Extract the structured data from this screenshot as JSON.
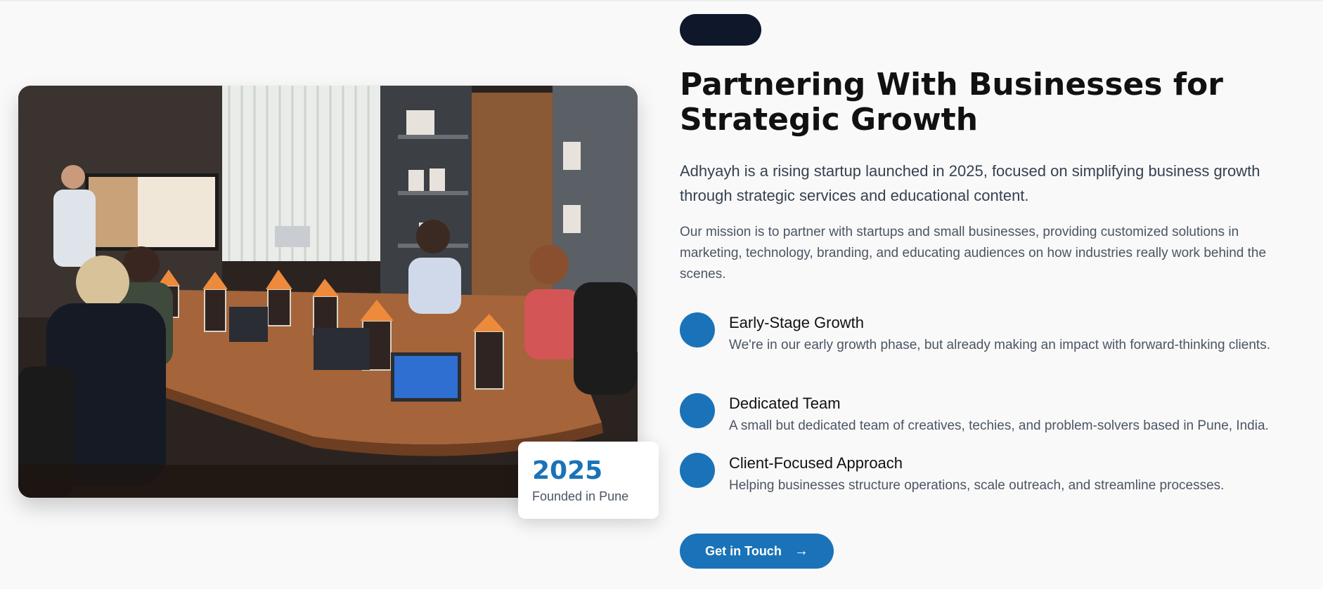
{
  "hero": {
    "heading": "Partnering With Businesses for Strategic Growth",
    "lead": "Adhyayh is a rising startup launched in 2025, focused on simplifying business growth through strategic services and educational content.",
    "mission": "Our mission is to partner with startups and small businesses, providing customized solutions in marketing, technology, branding, and educating audiences on how industries really work behind the scenes."
  },
  "stat": {
    "value": "2025",
    "label": "Founded in Pune"
  },
  "features": [
    {
      "title": "Early-Stage Growth",
      "description": "We're in our early growth phase, but already making an impact with forward-thinking clients."
    },
    {
      "title": "Dedicated Team",
      "description": "A small but dedicated team of creatives, techies, and problem-solvers based in Pune, India."
    },
    {
      "title": "Client-Focused Approach",
      "description": "Helping businesses structure operations, scale outreach, and streamline processes."
    }
  ],
  "cta": {
    "label": "Get in Touch",
    "icon": "arrow-right-icon"
  },
  "colors": {
    "accent": "#1a73b8",
    "pill": "#0f172a",
    "background": "#f9f9f9"
  }
}
